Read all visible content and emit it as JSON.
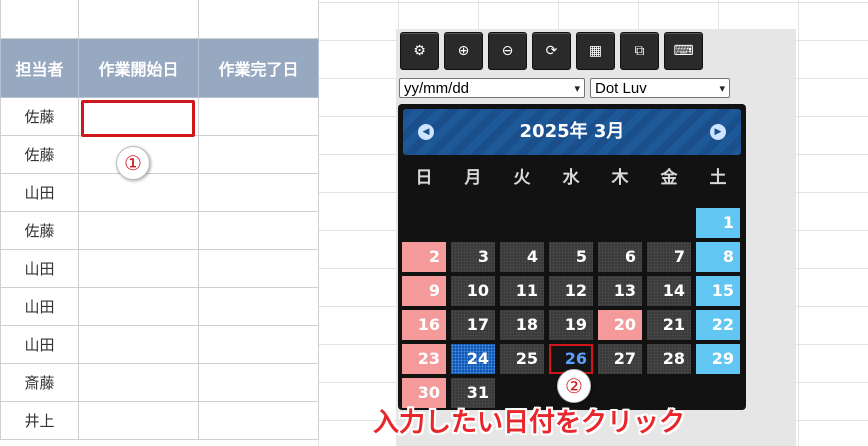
{
  "sheet": {
    "headers": [
      "担当者",
      "作業開始日",
      "作業完了日"
    ],
    "rows": [
      "佐藤",
      "佐藤",
      "山田",
      "佐藤",
      "山田",
      "山田",
      "山田",
      "斎藤",
      "井上"
    ]
  },
  "callouts": {
    "first": "①",
    "second": "②"
  },
  "toolbar": [
    {
      "icon": "gear-icon",
      "glyph": "⚙"
    },
    {
      "icon": "zoom-in-icon",
      "glyph": "⊕"
    },
    {
      "icon": "zoom-out-icon",
      "glyph": "⊖"
    },
    {
      "icon": "refresh-icon",
      "glyph": "⟳"
    },
    {
      "icon": "calendar-grid-icon",
      "glyph": "▦"
    },
    {
      "icon": "window-icon",
      "glyph": "⧉"
    },
    {
      "icon": "keyboard-icon",
      "glyph": "⌨"
    }
  ],
  "date_format_select": {
    "value": "yy/mm/dd",
    "arrow": "▾"
  },
  "theme_select": {
    "value": "Dot Luv",
    "arrow": "▾"
  },
  "calendar": {
    "title": "2025年 3月",
    "prev": "◀",
    "next": "▶",
    "weekdays": [
      "日",
      "月",
      "火",
      "水",
      "木",
      "金",
      "土"
    ],
    "days": [
      [
        "",
        "",
        "",
        "",
        "",
        "",
        "1"
      ],
      [
        "2",
        "3",
        "4",
        "5",
        "6",
        "7",
        "8"
      ],
      [
        "9",
        "10",
        "11",
        "12",
        "13",
        "14",
        "15"
      ],
      [
        "16",
        "17",
        "18",
        "19",
        "20",
        "21",
        "22"
      ],
      [
        "23",
        "24",
        "25",
        "26",
        "27",
        "28",
        "29"
      ],
      [
        "30",
        "31",
        "",
        "",
        "",
        "",
        ""
      ]
    ],
    "holiday": "20",
    "today": "24",
    "selected": "26"
  },
  "caption": "入力したい日付をクリック",
  "colors": {
    "accent_red": "#d0161d",
    "header_bg": "#97a9c0",
    "sunday": "#f59a9a",
    "saturday": "#62c6f3",
    "calendar_header": "#1a4f8c"
  }
}
